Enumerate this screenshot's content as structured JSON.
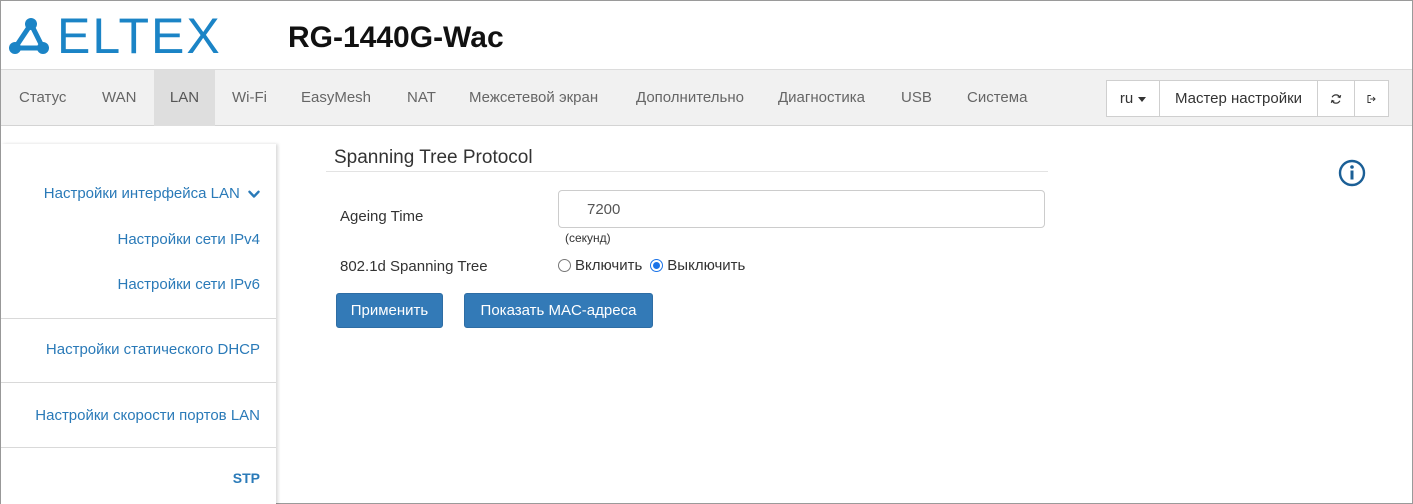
{
  "header": {
    "logo_text": "ELTEX",
    "model": "RG-1440G-Wac"
  },
  "nav": {
    "items": [
      {
        "label": "Статус"
      },
      {
        "label": "WAN"
      },
      {
        "label": "LAN"
      },
      {
        "label": "Wi-Fi"
      },
      {
        "label": "EasyMesh"
      },
      {
        "label": "NAT"
      },
      {
        "label": "Межсетевой экран"
      },
      {
        "label": "Дополнительно"
      },
      {
        "label": "Диагностика"
      },
      {
        "label": "USB"
      },
      {
        "label": "Система"
      }
    ],
    "active": "LAN",
    "language": "ru",
    "wizard_label": "Мастер настройки",
    "refresh_icon": "refresh-icon",
    "logout_icon": "logout-icon"
  },
  "sidebar": {
    "items": [
      {
        "label": "Настройки интерфейса LAN"
      },
      {
        "label": "Настройки сети IPv4"
      },
      {
        "label": "Настройки сети IPv6"
      },
      {
        "label": "Настройки статического DHCP"
      },
      {
        "label": "Настройки скорости портов LAN"
      },
      {
        "label": "STP"
      }
    ],
    "active": "STP"
  },
  "main": {
    "title": "Spanning Tree Protocol",
    "ageing_label": "Ageing Time",
    "ageing_value": "7200",
    "ageing_hint": "(секунд)",
    "stp_label": "802.1d Spanning Tree",
    "enable_label": "Включить",
    "disable_label": "Выключить",
    "selected": "Выключить",
    "apply_label": "Применить",
    "show_mac_label": "Показать MAC-адреса",
    "info_icon": "info-icon"
  },
  "colors": {
    "brand": "#1b84c6",
    "link": "#2a7ab8",
    "primary_button": "#337ab7",
    "radio_checked": "#1a73e8"
  }
}
